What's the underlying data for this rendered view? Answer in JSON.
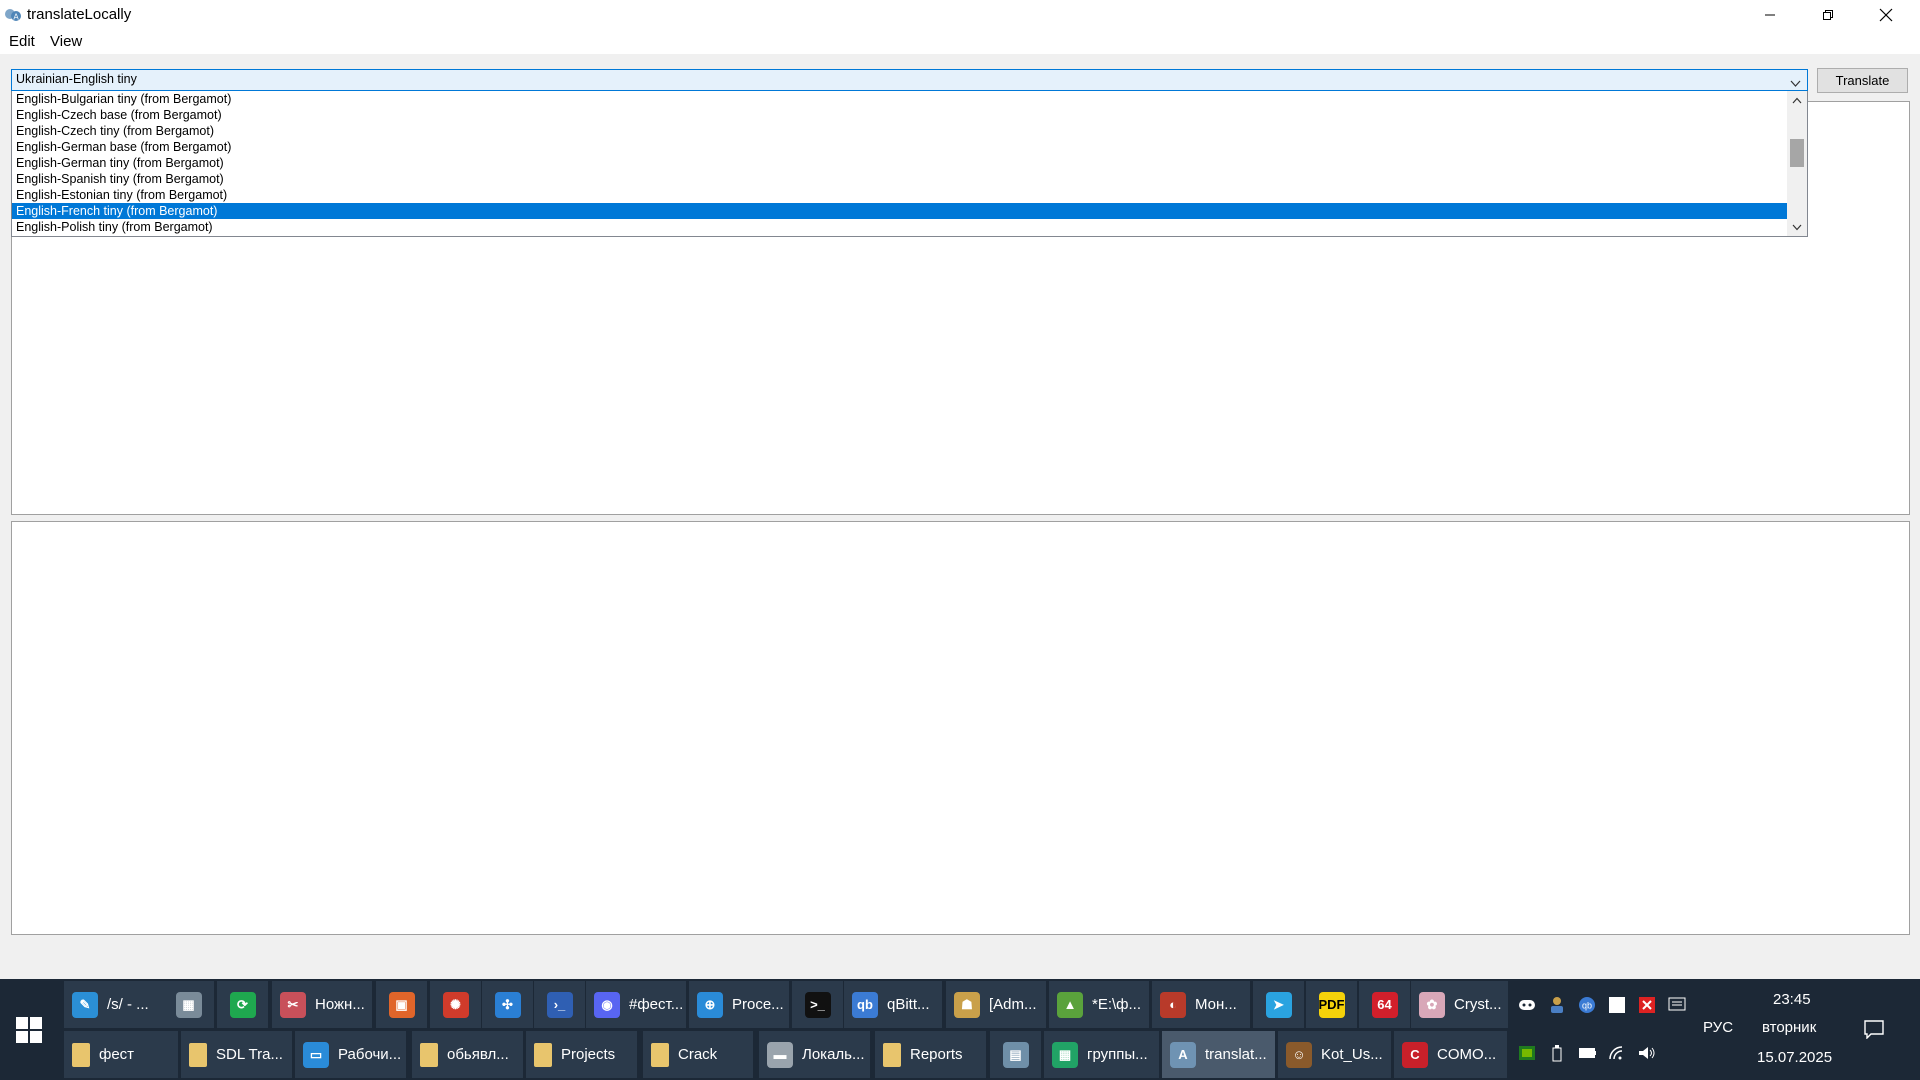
{
  "window": {
    "title": "translateLocally",
    "icon": "translate-app-icon",
    "controls": [
      "minimize-icon",
      "maximize-icon",
      "close-icon"
    ]
  },
  "menu": {
    "edit": "Edit",
    "view": "View"
  },
  "toolbar": {
    "translate_label": "Translate"
  },
  "model_select": {
    "value": "Ukrainian-English tiny",
    "options": [
      "English-Bulgarian tiny (from Bergamot)",
      "English-Czech base (from Bergamot)",
      "English-Czech tiny (from Bergamot)",
      "English-German base (from Bergamot)",
      "English-German tiny (from Bergamot)",
      "English-Spanish tiny (from Bergamot)",
      "English-Estonian tiny (from Bergamot)",
      "English-French tiny (from Bergamot)",
      "English-Polish tiny (from Bergamot)"
    ],
    "highlighted": "English-French tiny (from Bergamot)"
  },
  "taskbar": {
    "row1": [
      {
        "label": "/s/ - ...",
        "icon": "paint-icon",
        "color": "#2b8fd6"
      },
      {
        "label": "",
        "icon": "disk-icon",
        "color": "#7a8b99"
      },
      {
        "label": "",
        "icon": "sync-icon",
        "color": "#1fa84f"
      },
      {
        "label": "Ножн...",
        "icon": "scissors-icon",
        "color": "#c8505a"
      },
      {
        "label": "",
        "icon": "presentation-icon",
        "color": "#e0652a"
      },
      {
        "label": "",
        "icon": "ladybug-icon",
        "color": "#d03b2b"
      },
      {
        "label": "",
        "icon": "molecule-icon",
        "color": "#2a7fd4"
      },
      {
        "label": "",
        "icon": "powershell-icon",
        "color": "#2f5fb3"
      },
      {
        "label": "#фест...",
        "icon": "discord-icon",
        "color": "#5865f2"
      },
      {
        "label": "Proce...",
        "icon": "process-icon",
        "color": "#2a8bd8"
      },
      {
        "label": "",
        "icon": "terminal-icon",
        "color": "#111111"
      },
      {
        "label": "qBitt...",
        "icon": "qbittorrent-icon",
        "color": "#3b7bd4"
      },
      {
        "label": "[Adm...",
        "icon": "admin-icon",
        "color": "#c9a04a"
      },
      {
        "label": "*E:\\ф...",
        "icon": "image-editor-icon",
        "color": "#5aa23c"
      },
      {
        "label": "Мон...",
        "icon": "monitor-app-icon",
        "color": "#b83a2a"
      },
      {
        "label": "",
        "icon": "telegram-icon",
        "color": "#2aa3e0"
      },
      {
        "label": "",
        "icon": "pdf-icon",
        "color": "#f5d20a"
      },
      {
        "label": "",
        "icon": "aida64-icon",
        "color": "#d21f2b"
      },
      {
        "label": "Cryst...",
        "icon": "crystal-icon",
        "color": "#d8a7b8"
      }
    ],
    "row2": [
      {
        "label": "фест",
        "icon": "folder-icon",
        "color": "#e8c56d"
      },
      {
        "label": "SDL Tra...",
        "icon": "folder-icon",
        "color": "#e8c56d"
      },
      {
        "label": "Рабочи...",
        "icon": "desktop-icon",
        "color": "#2a8bd8"
      },
      {
        "label": "обьявл...",
        "icon": "folder-icon",
        "color": "#e8c56d"
      },
      {
        "label": "Projects",
        "icon": "folder-icon",
        "color": "#e8c56d"
      },
      {
        "label": "Crack",
        "icon": "folder-icon",
        "color": "#e8c56d"
      },
      {
        "label": "Локаль...",
        "icon": "drive-icon",
        "color": "#9aa4ad"
      },
      {
        "label": "Reports",
        "icon": "folder-icon",
        "color": "#e8c56d"
      },
      {
        "label": "",
        "icon": "calculator-icon",
        "color": "#6f8fa8"
      },
      {
        "label": "группы...",
        "icon": "sheets-icon",
        "color": "#21a366"
      },
      {
        "label": "translat...",
        "icon": "translate-app-icon",
        "color": "#6f93b3",
        "active": true
      },
      {
        "label": "Kot_Us...",
        "icon": "game-icon",
        "color": "#8a5a2b"
      },
      {
        "label": "COMO...",
        "icon": "comodo-icon",
        "color": "#c8202a"
      }
    ],
    "tray": {
      "language": "РУС",
      "time": "23:45",
      "day": "вторник",
      "date": "15.07.2025"
    }
  }
}
